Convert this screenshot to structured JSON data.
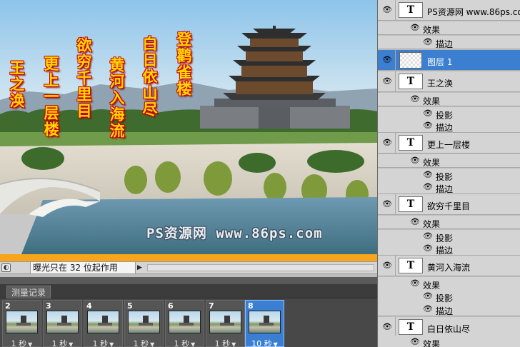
{
  "canvas": {
    "poem": [
      "登鹳雀楼",
      "白日依山尽",
      "黄河入海流",
      "欲穷千里目",
      "更上一层楼",
      "王之涣"
    ],
    "watermark": "PS资源网 www.86ps.com"
  },
  "status_bar": {
    "icon": "status-toggle-icon",
    "text": "曝光只在 32 位起作用",
    "arrow": "▶"
  },
  "animation": {
    "tab_label": "测量记录",
    "frames": [
      {
        "number": "2",
        "delay": "1 秒",
        "selected": false
      },
      {
        "number": "3",
        "delay": "1 秒",
        "selected": false
      },
      {
        "number": "4",
        "delay": "1 秒",
        "selected": false
      },
      {
        "number": "5",
        "delay": "1 秒",
        "selected": false
      },
      {
        "number": "6",
        "delay": "1 秒",
        "selected": false
      },
      {
        "number": "7",
        "delay": "1 秒",
        "selected": false
      },
      {
        "number": "8",
        "delay": "10 秒",
        "selected": true
      }
    ],
    "delay_arrow": "▼"
  },
  "layers": {
    "eye_glyph": "👁",
    "fx_label": "效果",
    "stroke_label": "描边",
    "shadow_label": "投影",
    "type_thumb": "T",
    "items": [
      {
        "name": "PS资源网 www.86ps.com",
        "kind": "text"
      },
      {
        "name": "图层 1",
        "kind": "pixel",
        "selected": true
      },
      {
        "name": "王之涣",
        "kind": "text"
      },
      {
        "name": "更上一层楼",
        "kind": "text"
      },
      {
        "name": "欲穷千里目",
        "kind": "text"
      },
      {
        "name": "黄河入海流",
        "kind": "text"
      },
      {
        "name": "白日依山尽",
        "kind": "text"
      }
    ]
  },
  "colors": {
    "selection": "#3c7fd0",
    "poem_fill": "#ffd800",
    "poem_stroke": "#d00000",
    "status_strip": "#f7a51a"
  }
}
